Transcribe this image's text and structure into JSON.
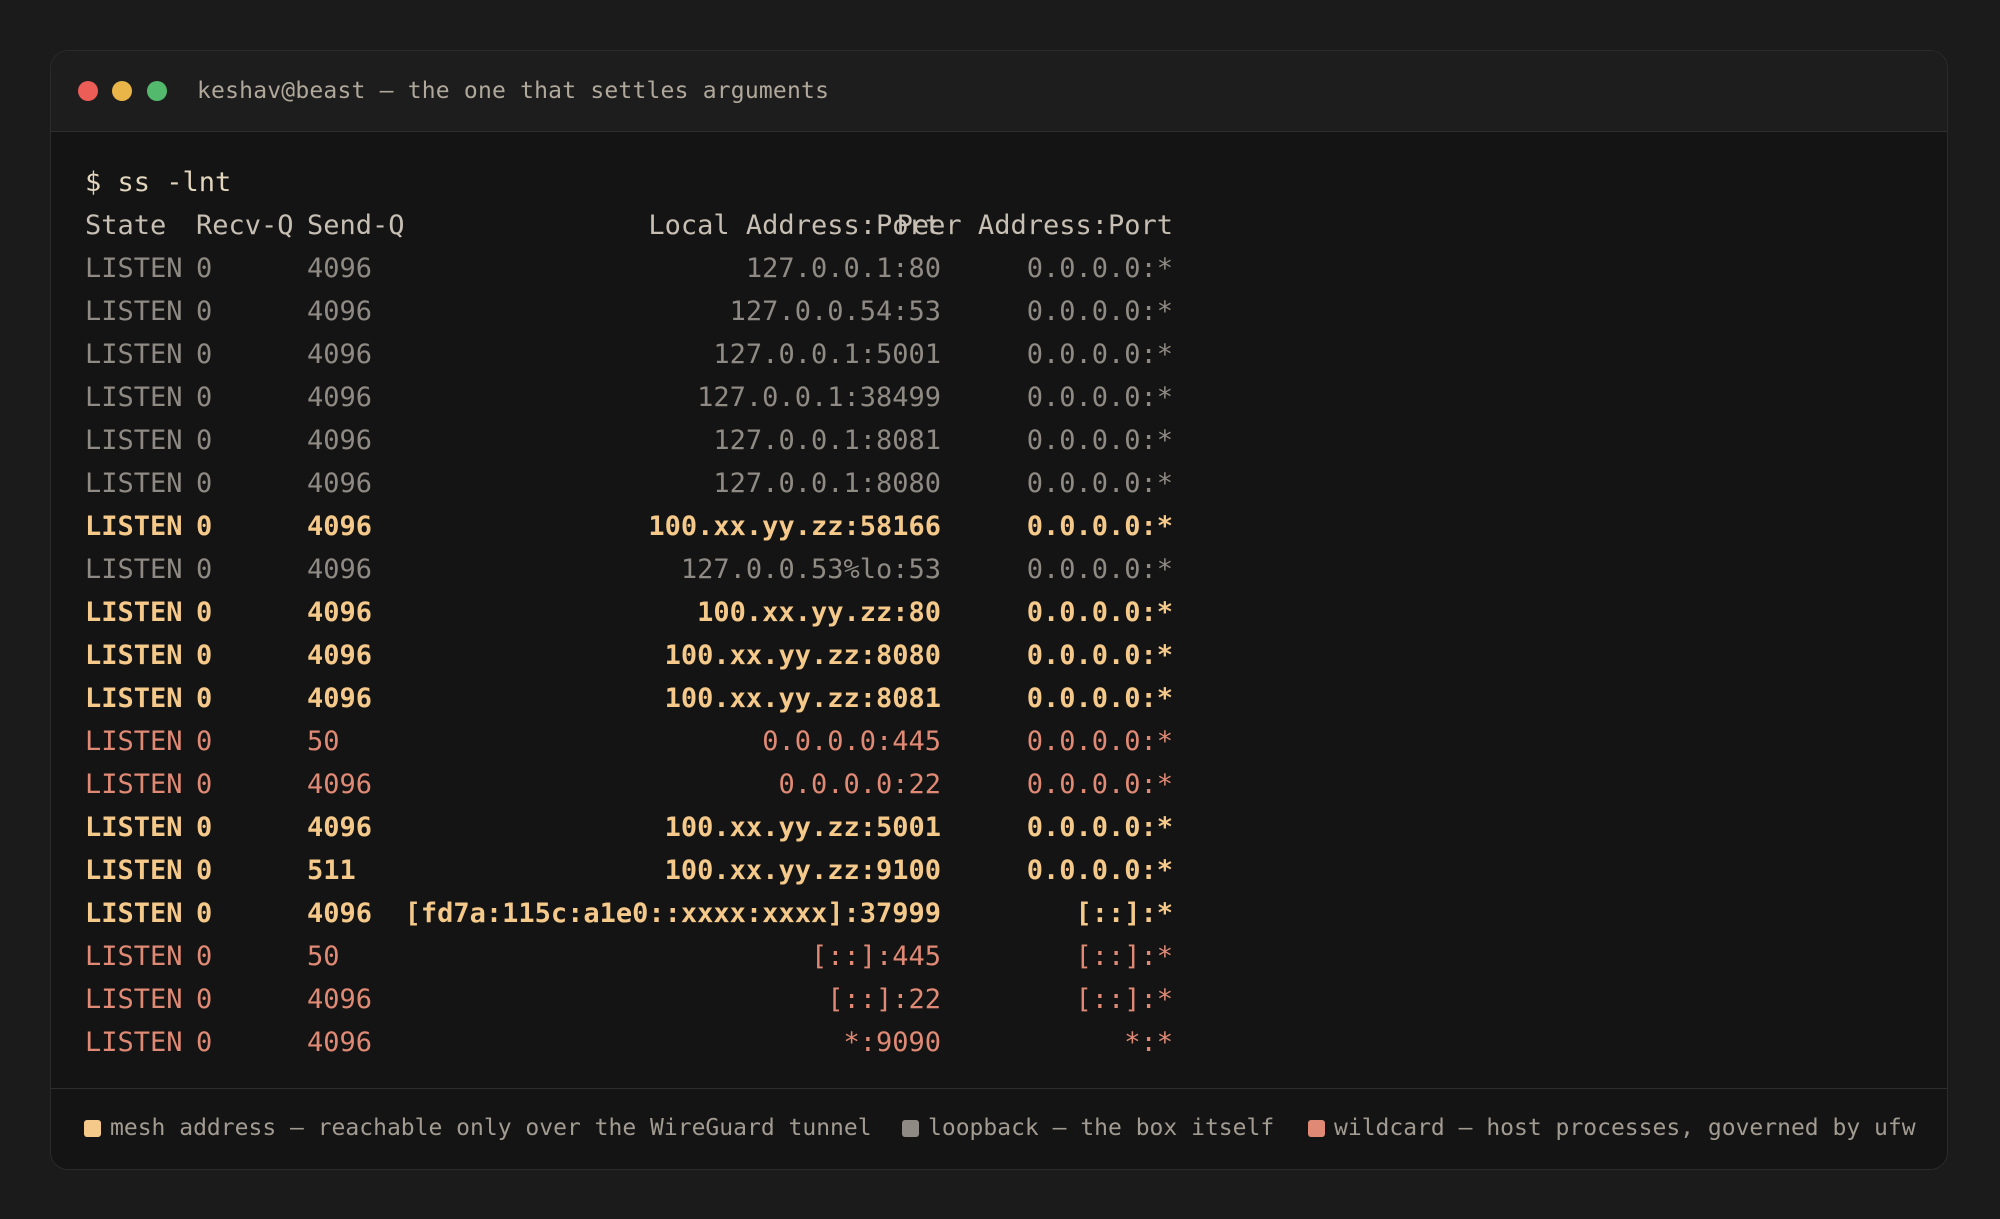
{
  "window": {
    "title": "keshav@beast — the one that settles arguments"
  },
  "terminal": {
    "prompt": "$ ss -lnt",
    "headers": {
      "state": "State",
      "recvq": "Recv-Q",
      "sendq": "Send-Q",
      "local": "Local Address:Port",
      "peer": "Peer Address:Port"
    },
    "rows": [
      {
        "state": "LISTEN",
        "recvq": "0",
        "sendq": "4096",
        "local": "127.0.0.1:80",
        "peer": "0.0.0.0:*",
        "kind": "loopback"
      },
      {
        "state": "LISTEN",
        "recvq": "0",
        "sendq": "4096",
        "local": "127.0.0.54:53",
        "peer": "0.0.0.0:*",
        "kind": "loopback"
      },
      {
        "state": "LISTEN",
        "recvq": "0",
        "sendq": "4096",
        "local": "127.0.0.1:5001",
        "peer": "0.0.0.0:*",
        "kind": "loopback"
      },
      {
        "state": "LISTEN",
        "recvq": "0",
        "sendq": "4096",
        "local": "127.0.0.1:38499",
        "peer": "0.0.0.0:*",
        "kind": "loopback"
      },
      {
        "state": "LISTEN",
        "recvq": "0",
        "sendq": "4096",
        "local": "127.0.0.1:8081",
        "peer": "0.0.0.0:*",
        "kind": "loopback"
      },
      {
        "state": "LISTEN",
        "recvq": "0",
        "sendq": "4096",
        "local": "127.0.0.1:8080",
        "peer": "0.0.0.0:*",
        "kind": "loopback"
      },
      {
        "state": "LISTEN",
        "recvq": "0",
        "sendq": "4096",
        "local": "100.xx.yy.zz:58166",
        "peer": "0.0.0.0:*",
        "kind": "mesh"
      },
      {
        "state": "LISTEN",
        "recvq": "0",
        "sendq": "4096",
        "local": "127.0.0.53%lo:53",
        "peer": "0.0.0.0:*",
        "kind": "loopback"
      },
      {
        "state": "LISTEN",
        "recvq": "0",
        "sendq": "4096",
        "local": "100.xx.yy.zz:80",
        "peer": "0.0.0.0:*",
        "kind": "mesh"
      },
      {
        "state": "LISTEN",
        "recvq": "0",
        "sendq": "4096",
        "local": "100.xx.yy.zz:8080",
        "peer": "0.0.0.0:*",
        "kind": "mesh"
      },
      {
        "state": "LISTEN",
        "recvq": "0",
        "sendq": "4096",
        "local": "100.xx.yy.zz:8081",
        "peer": "0.0.0.0:*",
        "kind": "mesh"
      },
      {
        "state": "LISTEN",
        "recvq": "0",
        "sendq": "50",
        "local": "0.0.0.0:445",
        "peer": "0.0.0.0:*",
        "kind": "wild"
      },
      {
        "state": "LISTEN",
        "recvq": "0",
        "sendq": "4096",
        "local": "0.0.0.0:22",
        "peer": "0.0.0.0:*",
        "kind": "wild"
      },
      {
        "state": "LISTEN",
        "recvq": "0",
        "sendq": "4096",
        "local": "100.xx.yy.zz:5001",
        "peer": "0.0.0.0:*",
        "kind": "mesh"
      },
      {
        "state": "LISTEN",
        "recvq": "0",
        "sendq": "511",
        "local": "100.xx.yy.zz:9100",
        "peer": "0.0.0.0:*",
        "kind": "mesh"
      },
      {
        "state": "LISTEN",
        "recvq": "0",
        "sendq": "4096",
        "local": "[fd7a:115c:a1e0::xxxx:xxxx]:37999",
        "peer": "[::]:*",
        "kind": "mesh"
      },
      {
        "state": "LISTEN",
        "recvq": "0",
        "sendq": "50",
        "local": "[::]:445",
        "peer": "[::]:*",
        "kind": "wild"
      },
      {
        "state": "LISTEN",
        "recvq": "0",
        "sendq": "4096",
        "local": "[::]:22",
        "peer": "[::]:*",
        "kind": "wild"
      },
      {
        "state": "LISTEN",
        "recvq": "0",
        "sendq": "4096",
        "local": "*:9090",
        "peer": "*:*",
        "kind": "wild"
      }
    ]
  },
  "legend": [
    {
      "label": "mesh address — reachable only over the WireGuard tunnel",
      "color": "#f5c98a"
    },
    {
      "label": "loopback — the box itself",
      "color": "#8f8a83"
    },
    {
      "label": "wildcard — host processes, governed by ufw",
      "color": "#e08a75"
    }
  ],
  "colors": {
    "mesh": "#f5c98a",
    "loopback": "#8f8a83",
    "wild": "#e08a75"
  }
}
